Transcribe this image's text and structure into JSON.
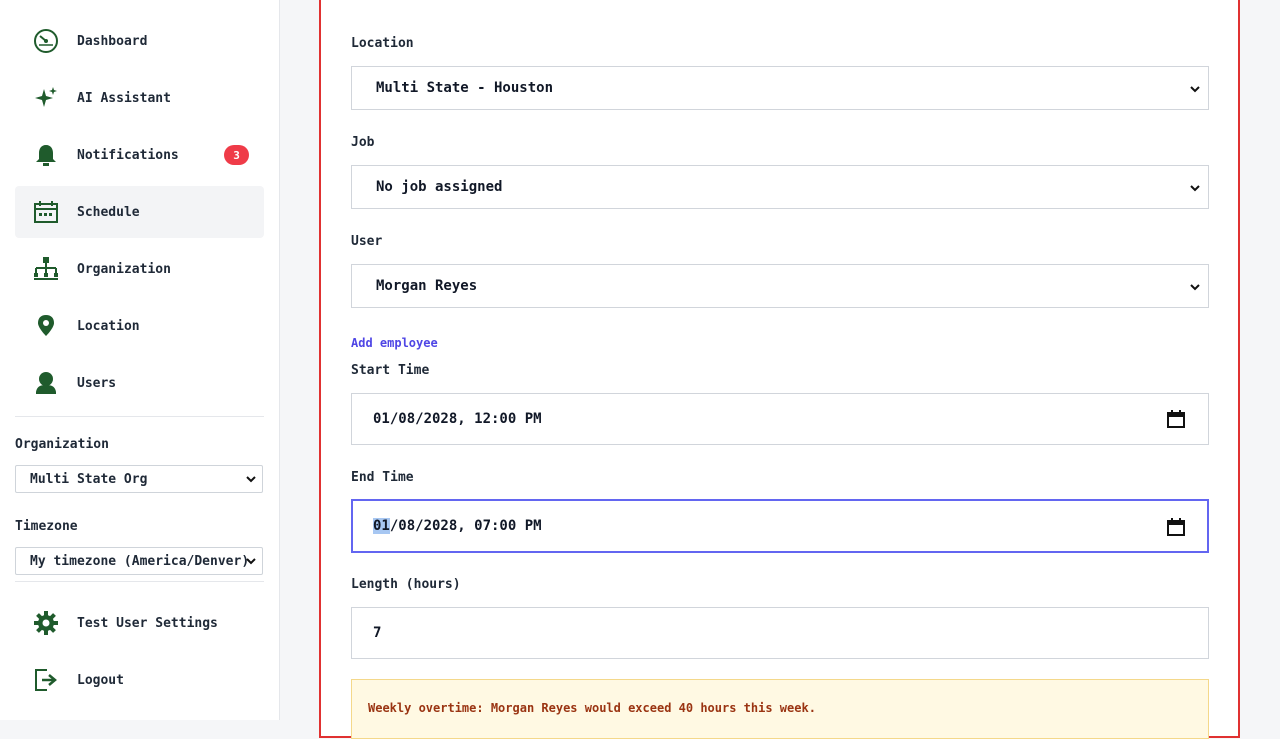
{
  "sidebar": {
    "nav": [
      {
        "label": "Dashboard",
        "icon": "dashboard-gauge-icon"
      },
      {
        "label": "AI Assistant",
        "icon": "sparkle-icon"
      },
      {
        "label": "Notifications",
        "icon": "bell-icon",
        "badge": "3"
      },
      {
        "label": "Schedule",
        "icon": "calendar-icon",
        "active": true
      },
      {
        "label": "Organization",
        "icon": "org-chart-icon"
      },
      {
        "label": "Location",
        "icon": "map-pin-icon"
      },
      {
        "label": "Users",
        "icon": "user-icon"
      }
    ],
    "organization": {
      "label": "Organization",
      "value": "Multi State Org"
    },
    "timezone": {
      "label": "Timezone",
      "value": "My timezone (America/Denver)"
    },
    "bottom": [
      {
        "label": "Test User Settings",
        "icon": "gear-icon"
      },
      {
        "label": "Logout",
        "icon": "logout-icon"
      }
    ]
  },
  "form": {
    "location": {
      "label": "Location",
      "value": "Multi State - Houston"
    },
    "job": {
      "label": "Job",
      "value": "No job assigned"
    },
    "user": {
      "label": "User",
      "value": "Morgan Reyes"
    },
    "add_employee": "Add employee",
    "start_time": {
      "label": "Start Time",
      "value": "01/08/2028, 12:00 PM"
    },
    "end_time": {
      "label": "End Time",
      "month": "01",
      "rest": "/08/2028, 07:00 PM"
    },
    "length": {
      "label": "Length (hours)",
      "value": "7"
    },
    "warning": "Weekly overtime: Morgan Reyes would exceed 40 hours this week."
  },
  "colors": {
    "icon_green": "#1f5b2c",
    "badge_red": "#ef3b48",
    "panel_border": "#e03131",
    "focus_border": "#6366f1",
    "link": "#4f46e5",
    "warning_bg": "#fff9e3",
    "warning_text": "#9a3412"
  }
}
